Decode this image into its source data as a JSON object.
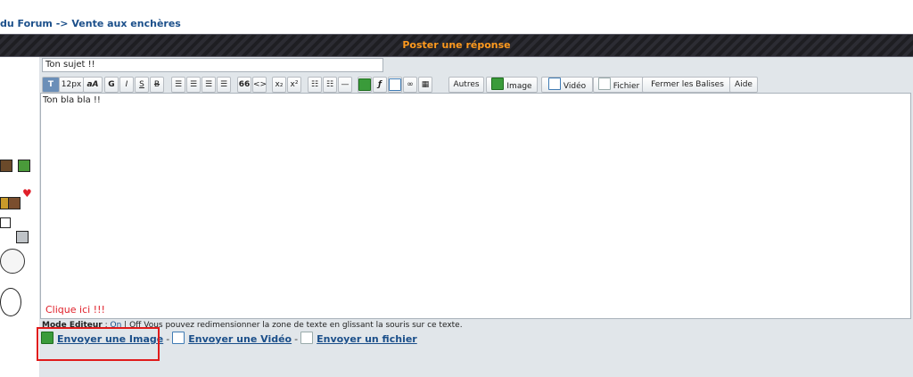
{
  "breadcrumb": {
    "forum": "du Forum",
    "sep": "->",
    "section": "Vente aux enchères"
  },
  "header": {
    "title": "Poster une réponse"
  },
  "form": {
    "subject_value": "Ton sujet !!",
    "message_text": "Ton bla bla !!"
  },
  "toolbar": {
    "font_size": "12px",
    "aa": "aA",
    "bold": "G",
    "italic": "I",
    "underline": "S",
    "strike": "B",
    "quote": "66",
    "code": "<>",
    "sub": "x₂",
    "sup": "x²",
    "buttons": {
      "autres": "Autres",
      "image": "Image",
      "video": "Vidéo",
      "fichier": "Fichier",
      "fermer": "Fermer les Balises",
      "aide": "Aide"
    }
  },
  "info": {
    "mode_label": "Mode Editeur",
    "on": "On",
    "off": "Off",
    "resize_hint": "Vous pouvez redimensionner la zone de texte en glissant la souris sur ce texte."
  },
  "annotation": {
    "clique": "Clique ici !!!"
  },
  "links": {
    "send_image": "Envoyer une Image",
    "dash": "-",
    "send_video": "Envoyer une Vidéo",
    "send_file": "Envoyer un fichier"
  },
  "colors": {
    "header_text": "#ff9a1e",
    "link": "#1b4f8a",
    "highlight": "#e01b1b",
    "panel": "#e1e6ea"
  }
}
